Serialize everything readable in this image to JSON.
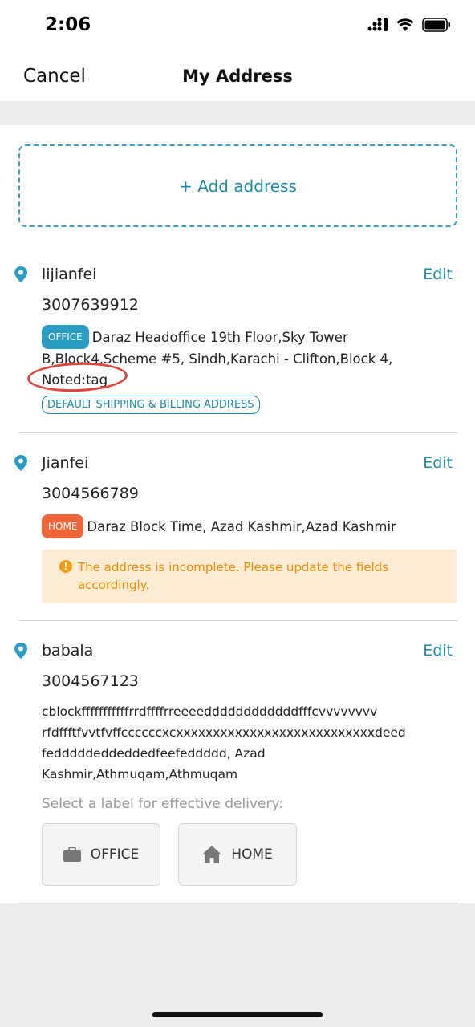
{
  "status": {
    "time": "2:06"
  },
  "nav": {
    "cancel": "Cancel",
    "title": "My Address"
  },
  "add_address": {
    "label": "+ Add address"
  },
  "addresses": [
    {
      "name": "lijianfei",
      "edit": "Edit",
      "phone": "3007639912",
      "tag": "OFFICE",
      "address": "Daraz Headoffice 19th Floor,Sky Tower B,Block4,Scheme #5, Sindh,Karachi - Clifton,Block 4,",
      "note": "Noted:tag",
      "badge": "DEFAULT SHIPPING & BILLING ADDRESS"
    },
    {
      "name": "Jianfei",
      "edit": "Edit",
      "phone": "3004566789",
      "tag": "HOME",
      "address": "Daraz Block Time, Azad Kashmir,Azad Kashmir",
      "warning": "The address is incomplete. Please update the fields accordingly."
    },
    {
      "name": "babala",
      "edit": "Edit",
      "phone": "3004567123",
      "address_lines": [
        "cblockfffffffffffrrdffffrreeeeddddddddddddfffcvvvvvvvv",
        "rfdffftfvvtfvffccccccxcxxxxxxxxxxxxxxxxxxxxxxxxxxxdeed",
        "fedddddeddeddedfeefeddddd, Azad",
        "Kashmir,Athmuqam,Athmuqam"
      ],
      "label_prompt": "Select a label for effective delivery:",
      "label_options": [
        "OFFICE",
        "HOME"
      ]
    }
  ],
  "colors": {
    "accent": "#1a8aad",
    "office_tag": "#2a9dc4",
    "home_tag": "#f2653a",
    "warning_bg": "#fcecd4",
    "warning_text": "#f08d00"
  },
  "icons": [
    "signal-icon",
    "wifi-icon",
    "battery-icon",
    "location-pin-icon",
    "warning-icon",
    "briefcase-icon",
    "home-icon"
  ]
}
